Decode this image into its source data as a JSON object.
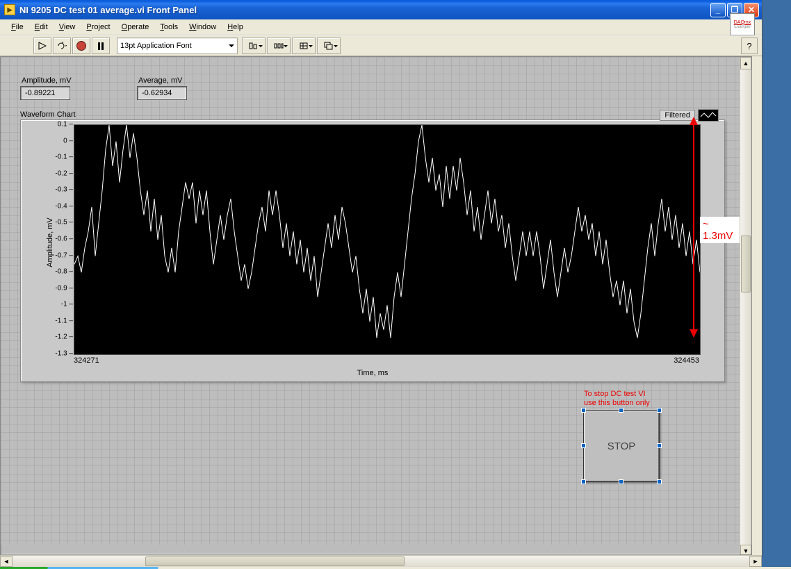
{
  "window": {
    "title": "NI 9205 DC test 01 average.vi Front Panel"
  },
  "menu": {
    "file": "File",
    "edit": "Edit",
    "view": "View",
    "project": "Project",
    "operate": "Operate",
    "tools": "Tools",
    "window": "Window",
    "help": "Help"
  },
  "toolbar": {
    "font": "13pt Application Font",
    "help_tooltip": "?",
    "daq_label": "DAQmx"
  },
  "indicators": {
    "amplitude_label": "Amplitude, mV",
    "amplitude_value": "-0.89221",
    "average_label": "Average, mV",
    "average_value": "-0.62934"
  },
  "chart": {
    "title": "Waveform Chart",
    "ylabel": "Amplitude, mV",
    "xlabel": "Time, ms",
    "legend": "Filtered",
    "x_min": "324271",
    "x_max": "324453",
    "y_ticks": [
      "0.1",
      "0",
      "-0.1",
      "-0.2",
      "-0.3",
      "-0.4",
      "-0.5",
      "-0.6",
      "-0.7",
      "-0.8",
      "-0.9",
      "-1",
      "-1.1",
      "-1.2",
      "-1.3"
    ]
  },
  "annotation": {
    "range_label": "~ 1.3mV"
  },
  "stop": {
    "caption": "To stop DC test VI\nuse this button only",
    "label": "STOP"
  },
  "chart_data": {
    "type": "line",
    "title": "Waveform Chart",
    "xlabel": "Time, ms",
    "ylabel": "Amplitude, mV",
    "xlim": [
      324271,
      324453
    ],
    "ylim": [
      -1.3,
      0.1
    ],
    "series": [
      {
        "name": "Filtered",
        "x_start": 324271,
        "x_step": 1,
        "values": [
          -0.75,
          -0.7,
          -0.8,
          -0.65,
          -0.55,
          -0.4,
          -0.7,
          -0.5,
          -0.3,
          -0.05,
          0.1,
          -0.15,
          0.0,
          -0.25,
          -0.05,
          0.1,
          -0.1,
          0.05,
          -0.1,
          -0.3,
          -0.45,
          -0.3,
          -0.55,
          -0.35,
          -0.6,
          -0.45,
          -0.7,
          -0.8,
          -0.65,
          -0.8,
          -0.55,
          -0.4,
          -0.25,
          -0.35,
          -0.25,
          -0.5,
          -0.3,
          -0.45,
          -0.3,
          -0.55,
          -0.75,
          -0.6,
          -0.45,
          -0.6,
          -0.45,
          -0.35,
          -0.55,
          -0.7,
          -0.85,
          -0.75,
          -0.9,
          -0.8,
          -0.65,
          -0.5,
          -0.4,
          -0.55,
          -0.3,
          -0.45,
          -0.3,
          -0.45,
          -0.65,
          -0.5,
          -0.7,
          -0.55,
          -0.75,
          -0.6,
          -0.8,
          -0.65,
          -0.85,
          -0.7,
          -0.95,
          -0.8,
          -0.65,
          -0.5,
          -0.65,
          -0.45,
          -0.6,
          -0.4,
          -0.5,
          -0.65,
          -0.8,
          -0.7,
          -0.9,
          -1.05,
          -0.9,
          -1.1,
          -0.95,
          -1.2,
          -1.05,
          -1.15,
          -1.0,
          -1.2,
          -0.95,
          -0.8,
          -0.95,
          -0.75,
          -0.55,
          -0.35,
          -0.2,
          0.0,
          0.1,
          -0.1,
          -0.25,
          -0.1,
          -0.3,
          -0.2,
          -0.4,
          -0.15,
          -0.35,
          -0.15,
          -0.3,
          -0.1,
          -0.25,
          -0.45,
          -0.3,
          -0.55,
          -0.4,
          -0.6,
          -0.45,
          -0.3,
          -0.5,
          -0.35,
          -0.55,
          -0.45,
          -0.65,
          -0.5,
          -0.7,
          -0.85,
          -0.7,
          -0.55,
          -0.7,
          -0.55,
          -0.7,
          -0.55,
          -0.7,
          -0.9,
          -0.75,
          -0.6,
          -0.8,
          -0.95,
          -0.8,
          -0.65,
          -0.8,
          -0.7,
          -0.55,
          -0.4,
          -0.55,
          -0.45,
          -0.6,
          -0.5,
          -0.7,
          -0.55,
          -0.75,
          -0.6,
          -0.8,
          -0.95,
          -0.85,
          -1.0,
          -0.85,
          -1.05,
          -0.9,
          -1.1,
          -1.2,
          -1.05,
          -0.85,
          -0.65,
          -0.5,
          -0.7,
          -0.5,
          -0.35,
          -0.55,
          -0.4,
          -0.6,
          -0.45,
          -0.65,
          -0.5,
          -0.7,
          -0.55,
          -0.75,
          -0.6,
          -0.8
        ]
      }
    ]
  }
}
